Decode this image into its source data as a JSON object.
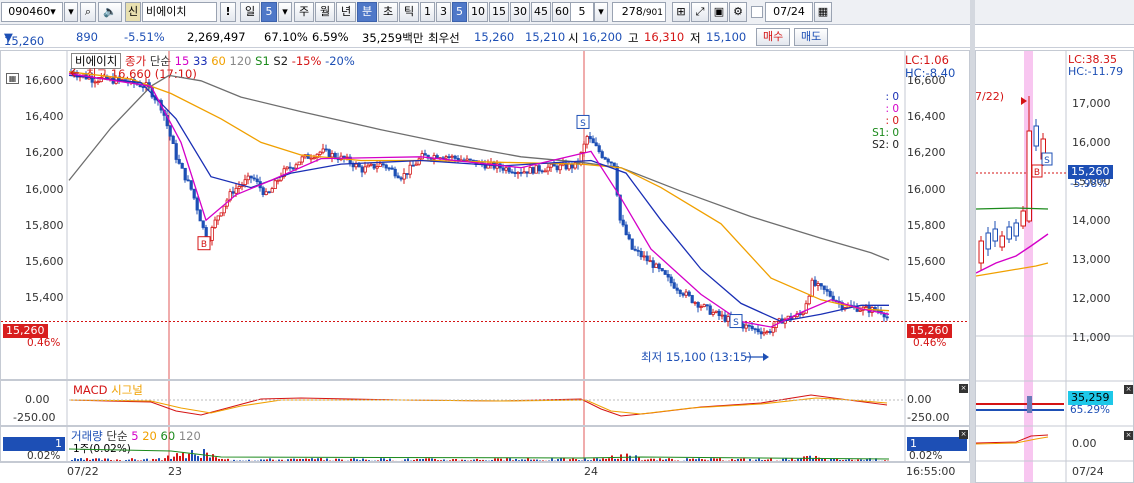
{
  "toolbar": {
    "stock_code": "090460",
    "search_icon": "search-icon",
    "sound_icon": "speaker-icon",
    "badge_new": "신",
    "stock_name": "비에이치",
    "alert_label": "!",
    "period_day": "일",
    "period_num": "5",
    "period_week": "주",
    "period_month": "월",
    "period_year": "년",
    "period_minute": "분",
    "period_sec": "초",
    "period_tick": "틱",
    "intervals": [
      "1",
      "3",
      "5",
      "10",
      "15",
      "30",
      "45",
      "60"
    ],
    "selected_interval": "5",
    "count_value": "5",
    "page_info": "278",
    "page_total": "/901",
    "date_value": "07/24"
  },
  "info": {
    "price": "15,260",
    "change": "890",
    "change_pct": "-5.51%",
    "volume": "2,269,497",
    "vol_ratio": "67.10%",
    "turnover": "6.59%",
    "amount": "35,259백만",
    "best_bid_label": "최우선",
    "best_ask": "15,260",
    "best_bid": "15,210",
    "open_label": "시",
    "open": "16,200",
    "high_label": "고",
    "high": "16,310",
    "low_label": "저",
    "low": "15,100",
    "buy_button": "매수",
    "sell_button": "매도"
  },
  "main_chart": {
    "legend_name": "비에이치",
    "legend_close": "종가",
    "legend_simple": "단순",
    "ma_periods": [
      "15",
      "33",
      "60",
      "120"
    ],
    "legend_s1": "S1",
    "legend_s2": "S2",
    "legend_pct1": "-15%",
    "legend_pct2": "-20%",
    "high_marker": "최고 16,660 (17:10)",
    "low_marker": "최저 15,100 (13:15)",
    "lc_label": "LC:1.06",
    "hc_label": "HC:-8.40",
    "right_values": [
      ": 0",
      ": 0",
      ": 0",
      "S1: 0",
      "S2: 0"
    ],
    "y_ticks": [
      "16,600",
      "16,400",
      "16,200",
      "16,000",
      "15,800",
      "15,600",
      "15,400"
    ],
    "current_price_tag": "15,260",
    "current_pct": "0.46%"
  },
  "macd": {
    "title": "MACD",
    "signal": "시그널",
    "y_ticks": [
      "0.00",
      "-250.00"
    ]
  },
  "volume": {
    "title": "거래량",
    "legend_simple": "단순",
    "ma_periods": [
      "5",
      "20",
      "60",
      "120"
    ],
    "info": "1주(0.02%)",
    "tag_value": "1",
    "tag_pct": "0.02%"
  },
  "x_axis": {
    "labels": [
      "07/22",
      "23",
      "24"
    ],
    "time": "16:55:00"
  },
  "side_chart": {
    "lc_label": "LC:38.35",
    "hc_label": "HC:-11.79",
    "date_marker": "7/22)",
    "y_ticks": [
      "17,000",
      "16,000",
      "15,000",
      "14,000",
      "13,000",
      "12,000",
      "11,000"
    ],
    "price_tag": "15,260",
    "pct_tag": "-5.98%",
    "vol_tag": "35,259",
    "vol_pct": "65.29%",
    "macd_tick": "0.00",
    "x_label": "07/24"
  },
  "colors": {
    "up": "#d41414",
    "down": "#1d4fb5",
    "ma15": "#d400c8",
    "ma33": "#1a2fb5",
    "ma60": "#f0a000",
    "ma120": "#6e6e6e",
    "accent": "#4f78c8"
  }
}
